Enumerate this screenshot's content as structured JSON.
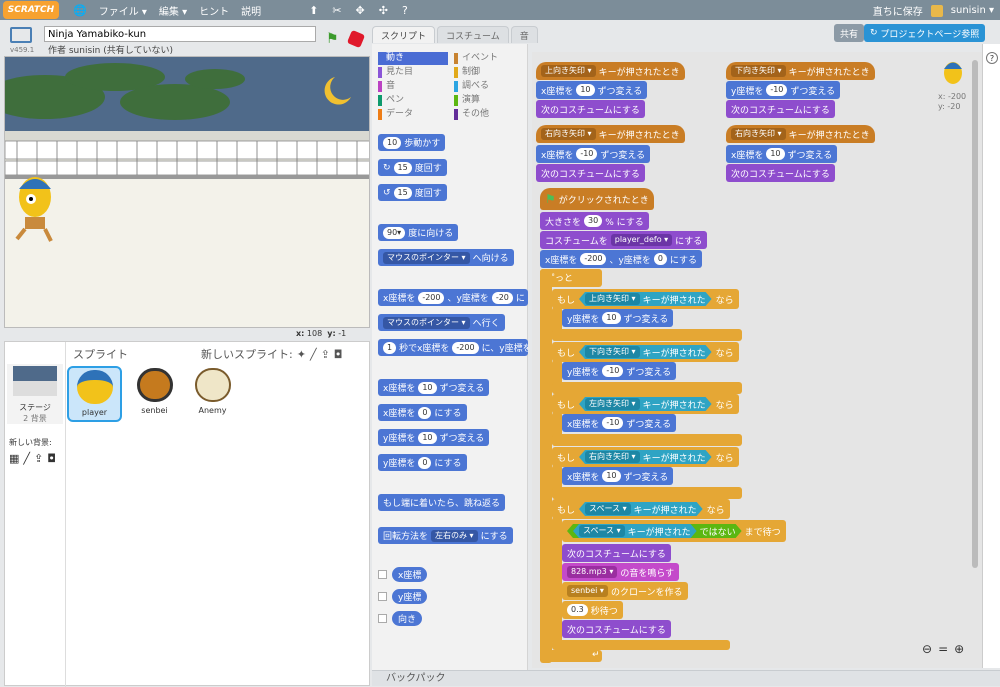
{
  "menubar": {
    "logo": "SCRATCH",
    "file": "ファイル ▾",
    "edit": "編集 ▾",
    "hint": "ヒント",
    "about": "説明",
    "save_now": "直ちに保存",
    "username": "sunisin ▾"
  },
  "project": {
    "title": "Ninja Yamabiko-kun",
    "author": "作者 sunisin (共有していない)",
    "version": "v459.1"
  },
  "stage": {
    "mouse_x_label": "x:",
    "mouse_x": "108",
    "mouse_y_label": "y:",
    "mouse_y": "-1"
  },
  "sprites_panel": {
    "label": "スプライト",
    "new_sprite": "新しいスプライト:",
    "stage_label": "ステージ",
    "stage_backdrops": "2 背景",
    "new_backdrop": "新しい背景:",
    "sprites": [
      "player",
      "senbei",
      "Anemy"
    ]
  },
  "tabs": [
    "スクリプト",
    "コスチューム",
    "音"
  ],
  "topbuttons": {
    "share": "共有",
    "project_page": "プロジェクトページ参照"
  },
  "categories": [
    {
      "label": "動き",
      "color": "#4a6cd4"
    },
    {
      "label": "イベント",
      "color": "#c88330"
    },
    {
      "label": "見た目",
      "color": "#8a55d7"
    },
    {
      "label": "制御",
      "color": "#e1a91a"
    },
    {
      "label": "音",
      "color": "#bb42c3"
    },
    {
      "label": "調べる",
      "color": "#2ca5e2"
    },
    {
      "label": "ペン",
      "color": "#0e9a6c"
    },
    {
      "label": "演算",
      "color": "#5cb712"
    },
    {
      "label": "データ",
      "color": "#ee7d16"
    },
    {
      "label": "その他",
      "color": "#632d99"
    }
  ],
  "palette": {
    "move": {
      "n": "10",
      "t": "歩動かす"
    },
    "turn_r": {
      "n": "15",
      "t": "度回す"
    },
    "turn_l": {
      "n": "15",
      "t": "度回す"
    },
    "point_dir": {
      "n": "90▾",
      "t": "度に向ける"
    },
    "point_towards": {
      "d": "マウスのポインター ▾",
      "t": "へ向ける"
    },
    "goto_xy": {
      "a": "x座標を",
      "x": "-200",
      "b": "、y座標を",
      "y": "-20",
      "c": "に"
    },
    "goto": {
      "d": "マウスのポインター ▾",
      "t": "へ行く"
    },
    "glide": {
      "n": "1",
      "a": "秒でx座標を",
      "x": "-200",
      "b": "に、y座標を"
    },
    "change_x": {
      "a": "x座標を",
      "n": "10",
      "b": "ずつ変える"
    },
    "set_x": {
      "a": "x座標を",
      "n": "0",
      "b": "にする"
    },
    "change_y": {
      "a": "y座標を",
      "n": "10",
      "b": "ずつ変える"
    },
    "set_y": {
      "a": "y座標を",
      "n": "0",
      "b": "にする"
    },
    "bounce": "もし端に着いたら、跳ね返る",
    "rotation": {
      "a": "回転方法を",
      "d": "左右のみ ▾",
      "b": "にする"
    },
    "xpos": "x座標",
    "ypos": "y座標",
    "direction": "向き"
  },
  "scripts": {
    "h_up": {
      "k": "上向き矢印 ▾",
      "t": "キーが押されたとき"
    },
    "up_change": {
      "a": "x座標を",
      "n": "10",
      "b": "ずつ変える"
    },
    "up_costume": "次のコスチュームにする",
    "h_down": {
      "k": "下向き矢印 ▾",
      "t": "キーが押されたとき"
    },
    "down_change": {
      "a": "y座標を",
      "n": "-10",
      "b": "ずつ変える"
    },
    "down_costume": "次のコスチュームにする",
    "h_right": {
      "k": "右向き矢印 ▾",
      "t": "キーが押されたとき"
    },
    "right_change": {
      "a": "x座標を",
      "n": "-10",
      "b": "ずつ変える"
    },
    "right_costume": "次のコスチュームにする",
    "h_right2": {
      "k": "右向き矢印 ▾",
      "t": "キーが押されたとき"
    },
    "right2_change": {
      "a": "x座標を",
      "n": "10",
      "b": "ずつ変える"
    },
    "right2_costume": "次のコスチュームにする",
    "h_flag": "がクリックされたとき",
    "size": {
      "a": "大きさを",
      "n": "30",
      "b": "% にする"
    },
    "costume": {
      "a": "コスチュームを",
      "d": "player_defo ▾",
      "b": "にする"
    },
    "gotoxy": {
      "a": "x座標を",
      "x": "-200",
      "b": "、y座標を",
      "y": "0",
      "c": "にする"
    },
    "forever": "ずっと",
    "if1": {
      "m": "もし",
      "k": "上向き矢印 ▾",
      "t": "キーが押された",
      "n": "なら"
    },
    "if1_body": {
      "a": "y座標を",
      "n": "10",
      "b": "ずつ変える"
    },
    "if2": {
      "m": "もし",
      "k": "下向き矢印 ▾",
      "t": "キーが押された",
      "n": "なら"
    },
    "if2_body": {
      "a": "y座標を",
      "n": "-10",
      "b": "ずつ変える"
    },
    "if3": {
      "m": "もし",
      "k": "左向き矢印 ▾",
      "t": "キーが押された",
      "n": "なら"
    },
    "if3_body": {
      "a": "x座標を",
      "n": "-10",
      "b": "ずつ変える"
    },
    "if4": {
      "m": "もし",
      "k": "右向き矢印 ▾",
      "t": "キーが押された",
      "n": "なら"
    },
    "if4_body": {
      "a": "x座標を",
      "n": "10",
      "b": "ずつ変える"
    },
    "if5": {
      "m": "もし",
      "k": "スペース ▾",
      "t": "キーが押された",
      "n": "なら"
    },
    "wait_until": {
      "k": "スペース ▾",
      "t": "キーが押された",
      "no": "ではない",
      "w": "まで待つ"
    },
    "next_costume1": "次のコスチュームにする",
    "play_sound": {
      "d": "828.mp3 ▾",
      "t": "の音を鳴らす"
    },
    "clone": {
      "d": "senbei ▾",
      "t": "のクローンを作る"
    },
    "wait": {
      "n": "0.3",
      "t": "秒待つ"
    },
    "next_costume2": "次のコスチュームにする"
  },
  "sprite_info": {
    "x": "x: -200",
    "y": "y: -20"
  },
  "backpack": "バックパック"
}
